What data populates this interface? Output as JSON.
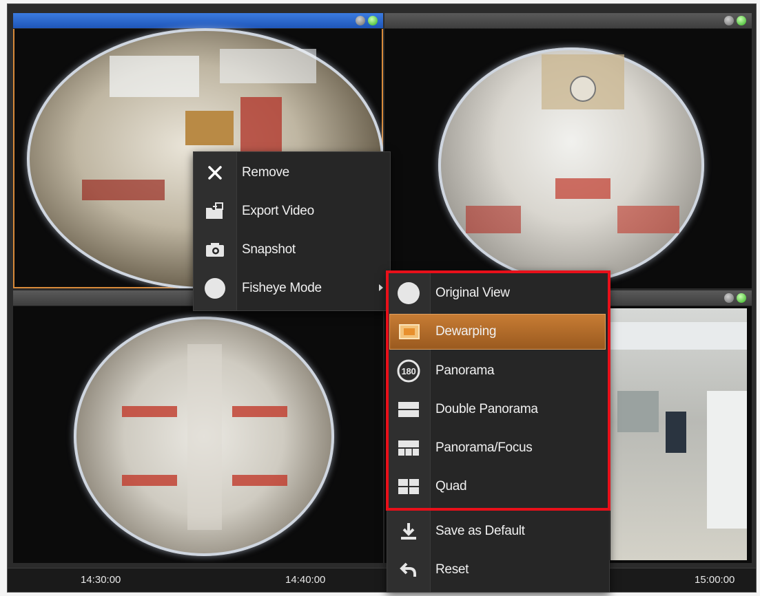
{
  "timeline": {
    "times": [
      "14:30:00",
      "14:40:00",
      "15:00:00"
    ]
  },
  "context_menu": {
    "items": [
      {
        "label": "Remove",
        "icon": "close-icon"
      },
      {
        "label": "Export Video",
        "icon": "export-folder-icon"
      },
      {
        "label": "Snapshot",
        "icon": "camera-icon"
      },
      {
        "label": "Fisheye Mode",
        "icon": "circle-icon"
      }
    ]
  },
  "fisheye_submenu": {
    "items": [
      {
        "label": "Original View",
        "icon": "circle-icon"
      },
      {
        "label": "Dewarping",
        "icon": "dewarping-icon",
        "active": true
      },
      {
        "label": "Panorama",
        "icon": "panorama-180-icon"
      },
      {
        "label": "Double Panorama",
        "icon": "double-panorama-icon"
      },
      {
        "label": "Panorama/Focus",
        "icon": "panorama-focus-icon"
      },
      {
        "label": "Quad",
        "icon": "quad-icon"
      },
      {
        "label": "Save as Default",
        "icon": "download-icon"
      },
      {
        "label": "Reset",
        "icon": "undo-icon"
      }
    ],
    "icon_180_text": "180"
  },
  "colors": {
    "highlight": "#e8101a",
    "accent": "#c77c34",
    "selected_border": "#d88a3a",
    "status_green": "#2fae1d"
  }
}
